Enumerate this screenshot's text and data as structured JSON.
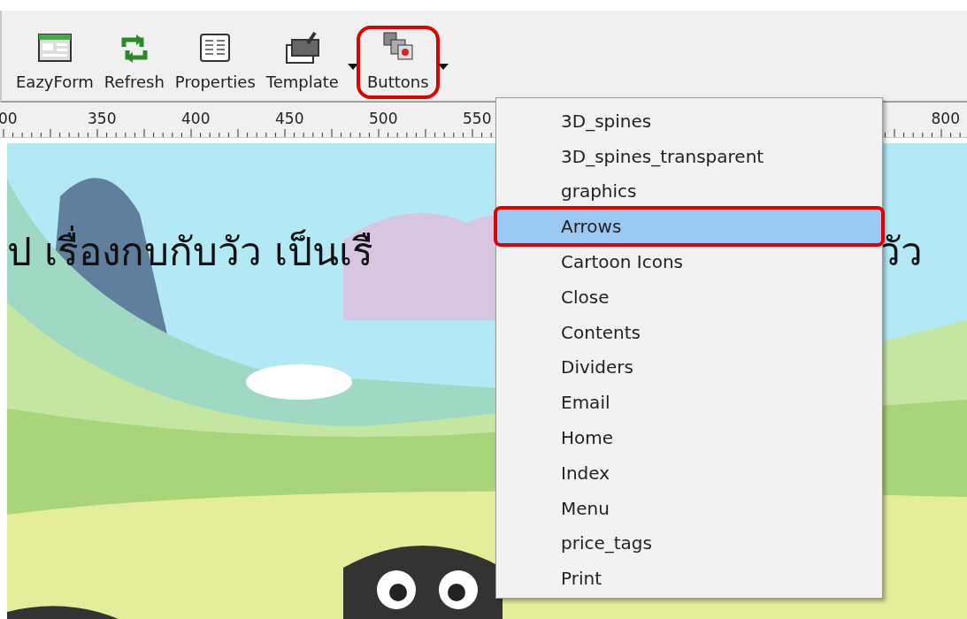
{
  "toolbar": {
    "buttons": [
      {
        "label": "EazyForm",
        "kind": "form",
        "dropdown": false,
        "highlighted": false
      },
      {
        "label": "Refresh",
        "kind": "refresh",
        "dropdown": false,
        "highlighted": false
      },
      {
        "label": "Properties",
        "kind": "properties",
        "dropdown": false,
        "highlighted": false
      },
      {
        "label": "Template",
        "kind": "template",
        "dropdown": true,
        "highlighted": false
      },
      {
        "label": "Buttons",
        "kind": "buttons",
        "dropdown": true,
        "highlighted": true
      }
    ]
  },
  "ruler": {
    "labels": [
      "00",
      "350",
      "400",
      "450",
      "500",
      "550",
      "800"
    ]
  },
  "canvas": {
    "title_fragments": [
      "ป เรื่องกบกับวัว เป็นเรื",
      "วัว"
    ]
  },
  "menu": {
    "items": [
      {
        "label": "3D_spines",
        "selected": false,
        "highlighted": false
      },
      {
        "label": "3D_spines_transparent",
        "selected": false,
        "highlighted": false
      },
      {
        "label": "graphics",
        "selected": false,
        "highlighted": false
      },
      {
        "label": "Arrows",
        "selected": true,
        "highlighted": true
      },
      {
        "label": "Cartoon Icons",
        "selected": false,
        "highlighted": false
      },
      {
        "label": "Close",
        "selected": false,
        "highlighted": false
      },
      {
        "label": "Contents",
        "selected": false,
        "highlighted": false
      },
      {
        "label": "Dividers",
        "selected": false,
        "highlighted": false
      },
      {
        "label": "Email",
        "selected": false,
        "highlighted": false
      },
      {
        "label": "Home",
        "selected": false,
        "highlighted": false
      },
      {
        "label": "Index",
        "selected": false,
        "highlighted": false
      },
      {
        "label": "Menu",
        "selected": false,
        "highlighted": false
      },
      {
        "label": "price_tags",
        "selected": false,
        "highlighted": false
      },
      {
        "label": "Print",
        "selected": false,
        "highlighted": false
      }
    ]
  }
}
